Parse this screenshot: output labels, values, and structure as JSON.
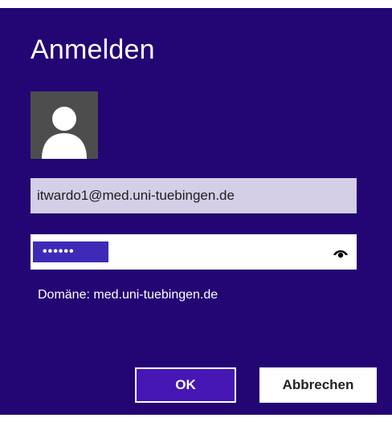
{
  "dialog": {
    "title": "Anmelden"
  },
  "avatar": {
    "icon": "user-silhouette-icon"
  },
  "username": {
    "value": "itwardo1@med.uni-tuebingen.de"
  },
  "password": {
    "masked_value": "••••••",
    "reveal_icon": "eye-icon"
  },
  "domain": {
    "text": "Domäne: med.uni-tuebingen.de"
  },
  "buttons": {
    "ok_label": "OK",
    "cancel_label": "Abbrechen"
  },
  "colors": {
    "background": "#240574",
    "accent": "#4617b4",
    "selection": "#3f2ab8",
    "field_username": "#d4cee6"
  }
}
